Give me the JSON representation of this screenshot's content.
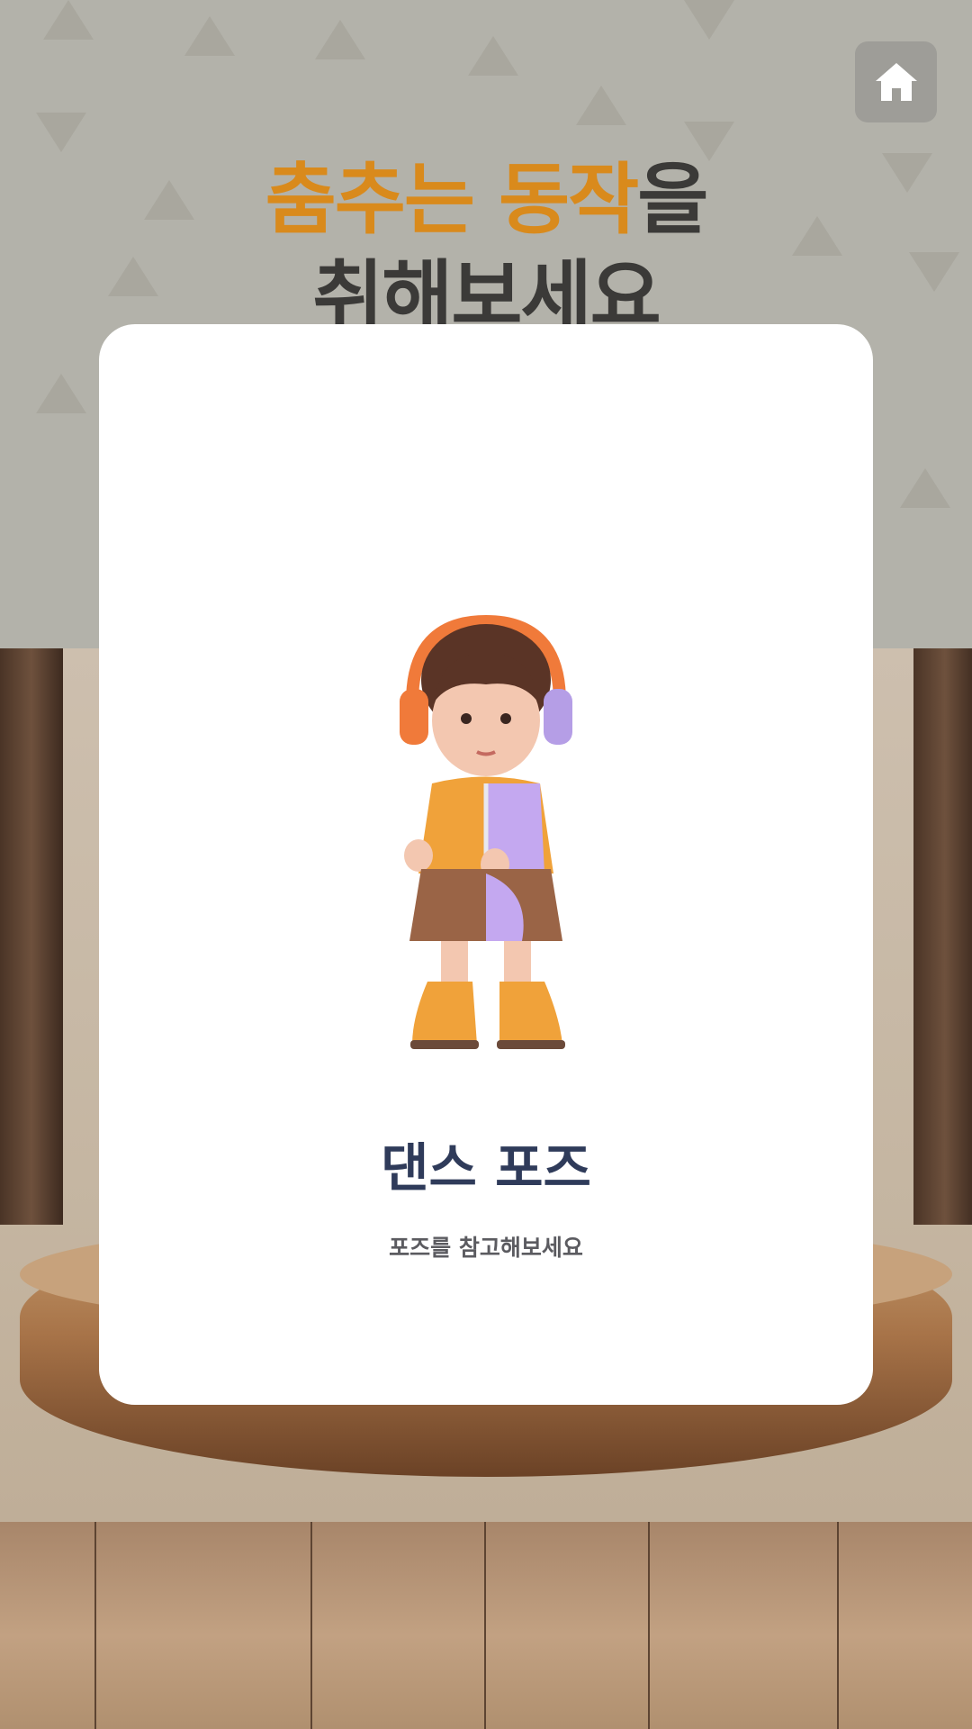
{
  "header": {
    "home_icon": "home-icon",
    "title_line1_accent": "춤추는 동작",
    "title_line1_rest": "을",
    "title_line2": "취해보세요"
  },
  "card": {
    "title": "댄스 포즈",
    "subtitle": "포즈를 참고해보세요"
  },
  "colors": {
    "accent": "#d98a1c",
    "title_text": "#3b3a38",
    "card_title": "#2f3b5a",
    "card_subtitle": "#5b5b60",
    "card_background": "#ffffff"
  }
}
